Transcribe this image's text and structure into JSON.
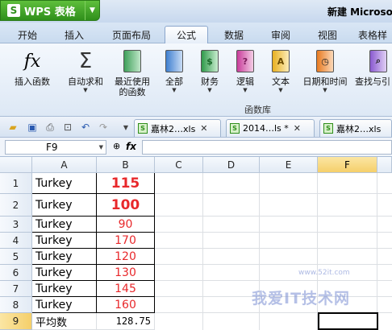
{
  "app": {
    "name": "WPS 表格",
    "logo_letter": "S",
    "window_title": "新建 Microso"
  },
  "tabs": [
    "开始",
    "插入",
    "页面布局",
    "公式",
    "数据",
    "审阅",
    "视图",
    "表格样"
  ],
  "active_tab": "公式",
  "ribbon": {
    "insert_function": "插入函数",
    "autosum": "自动求和",
    "recent_line1": "最近使用",
    "recent_line2": "的函数",
    "all": "全部",
    "finance": "财务",
    "logic": "逻辑",
    "text": "文本",
    "datetime": "日期和时间",
    "lookup": "查找与引",
    "group_label": "函数库",
    "icons": {
      "fx": "fx",
      "sigma": "Σ",
      "finance_glyph": "$",
      "logic_glyph": "?",
      "text_glyph": "A"
    }
  },
  "doc_tabs": [
    {
      "name": "嘉林2…xls",
      "close": "✕"
    },
    {
      "name": "2014…ls *",
      "close": "✕"
    },
    {
      "name": "嘉林2…xls",
      "close": "✕"
    }
  ],
  "formula_bar": {
    "cell_ref": "F9",
    "fx": "fx",
    "content": ""
  },
  "sheet": {
    "columns": [
      "A",
      "B",
      "C",
      "D",
      "E",
      "F"
    ],
    "selected_column": "F",
    "selected_row": "9",
    "rows": [
      {
        "num": "1",
        "a": "Turkey",
        "b": "115"
      },
      {
        "num": "2",
        "a": "Turkey",
        "b": "100"
      },
      {
        "num": "3",
        "a": "Turkey",
        "b": "90"
      },
      {
        "num": "4",
        "a": "Turkey",
        "b": "170"
      },
      {
        "num": "5",
        "a": "Turkey",
        "b": "120"
      },
      {
        "num": "6",
        "a": "Turkey",
        "b": "130"
      },
      {
        "num": "7",
        "a": "Turkey",
        "b": "145"
      },
      {
        "num": "8",
        "a": "Turkey",
        "b": "160"
      },
      {
        "num": "9",
        "a": "平均数",
        "b": "128.75"
      }
    ]
  },
  "watermark": {
    "text": "我爱IT技术网",
    "sub": "www.52it.com"
  },
  "colors": {
    "accent_green": "#2f8f1b",
    "value_red": "#e8282b",
    "selection": "#f5cf6a"
  }
}
